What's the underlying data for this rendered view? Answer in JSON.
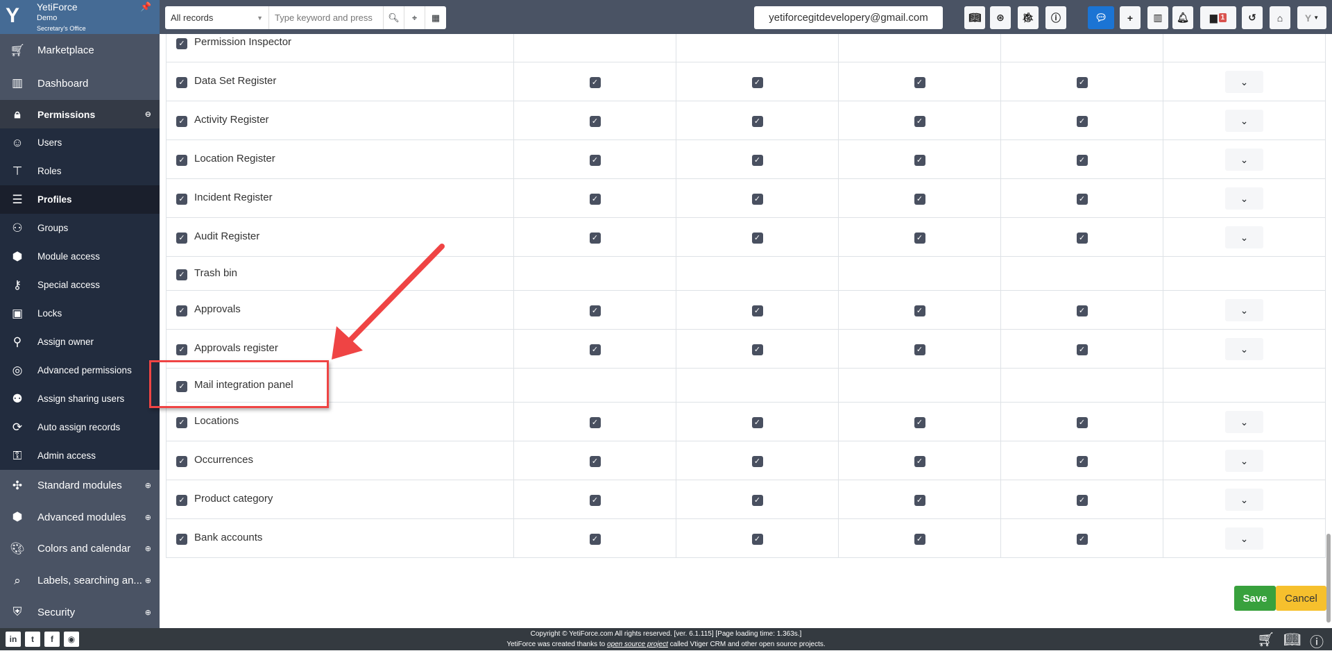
{
  "brand": {
    "name": "YetiForce",
    "company": "Demo",
    "office": "Secretary's Office"
  },
  "search": {
    "module": "All records",
    "placeholder": "Type keyword and press"
  },
  "header": {
    "email": "yetiforcegitdevelopery@gmail.com",
    "calendar_badge": "1"
  },
  "sidebar": {
    "items": [
      {
        "label": "Marketplace",
        "icon": "cart-icon",
        "level": "top"
      },
      {
        "label": "Dashboard",
        "icon": "dashboard-icon",
        "level": "top"
      },
      {
        "label": "Permissions",
        "icon": "lock-icon",
        "level": "open"
      },
      {
        "label": "Users",
        "icon": "users-icon",
        "level": "sub"
      },
      {
        "label": "Roles",
        "icon": "hierarchy-icon",
        "level": "sub"
      },
      {
        "label": "Profiles",
        "icon": "list-icon",
        "level": "sub",
        "active": true
      },
      {
        "label": "Groups",
        "icon": "groups-icon",
        "level": "sub"
      },
      {
        "label": "Module access",
        "icon": "cube-icon",
        "level": "sub"
      },
      {
        "label": "Special access",
        "icon": "key-icon",
        "level": "sub"
      },
      {
        "label": "Locks",
        "icon": "lock-window-icon",
        "level": "sub"
      },
      {
        "label": "Assign owner",
        "icon": "assign-owner-icon",
        "level": "sub"
      },
      {
        "label": "Advanced permissions",
        "icon": "fingerprint-icon",
        "level": "sub"
      },
      {
        "label": "Assign sharing users",
        "icon": "sharing-users-icon",
        "level": "sub"
      },
      {
        "label": "Auto assign records",
        "icon": "auto-assign-icon",
        "level": "sub"
      },
      {
        "label": "Admin access",
        "icon": "admin-lock-icon",
        "level": "sub"
      },
      {
        "label": "Standard modules",
        "icon": "puzzle-icon",
        "level": "bot"
      },
      {
        "label": "Advanced modules",
        "icon": "cube-icon",
        "level": "bot"
      },
      {
        "label": "Colors and calendar",
        "icon": "palette-icon",
        "level": "bot"
      },
      {
        "label": "Labels, searching an...",
        "icon": "search-labels-icon",
        "level": "bot"
      },
      {
        "label": "Security",
        "icon": "shield-icon",
        "level": "bot"
      }
    ]
  },
  "rows": [
    {
      "name": "Permission Inspector",
      "checked": true,
      "perms": false
    },
    {
      "name": "Data Set Register",
      "checked": true,
      "perms": true
    },
    {
      "name": "Activity Register",
      "checked": true,
      "perms": true
    },
    {
      "name": "Location Register",
      "checked": true,
      "perms": true
    },
    {
      "name": "Incident Register",
      "checked": true,
      "perms": true
    },
    {
      "name": "Audit Register",
      "checked": true,
      "perms": true
    },
    {
      "name": "Trash bin",
      "checked": true,
      "perms": false
    },
    {
      "name": "Approvals",
      "checked": true,
      "perms": true
    },
    {
      "name": "Approvals register",
      "checked": true,
      "perms": true
    },
    {
      "name": "Mail integration panel",
      "checked": true,
      "perms": false
    },
    {
      "name": "Locations",
      "checked": true,
      "perms": true
    },
    {
      "name": "Occurrences",
      "checked": true,
      "perms": true
    },
    {
      "name": "Product category",
      "checked": true,
      "perms": true
    },
    {
      "name": "Bank accounts",
      "checked": true,
      "perms": true
    }
  ],
  "actions": {
    "save": "Save",
    "cancel": "Cancel"
  },
  "footer": {
    "line1": "Copyright © YetiForce.com All rights reserved. [ver. 6.1.115] [Page loading time: 1.363s.]",
    "line2_pre": "YetiForce was created thanks to ",
    "line2_link": "open source project",
    "line2_post": " called Vtiger CRM and other open source projects."
  },
  "colors": {
    "accent": "#456b95",
    "highlight": "#ef4444",
    "save": "#38a13d",
    "cancel": "#f6c02d"
  }
}
